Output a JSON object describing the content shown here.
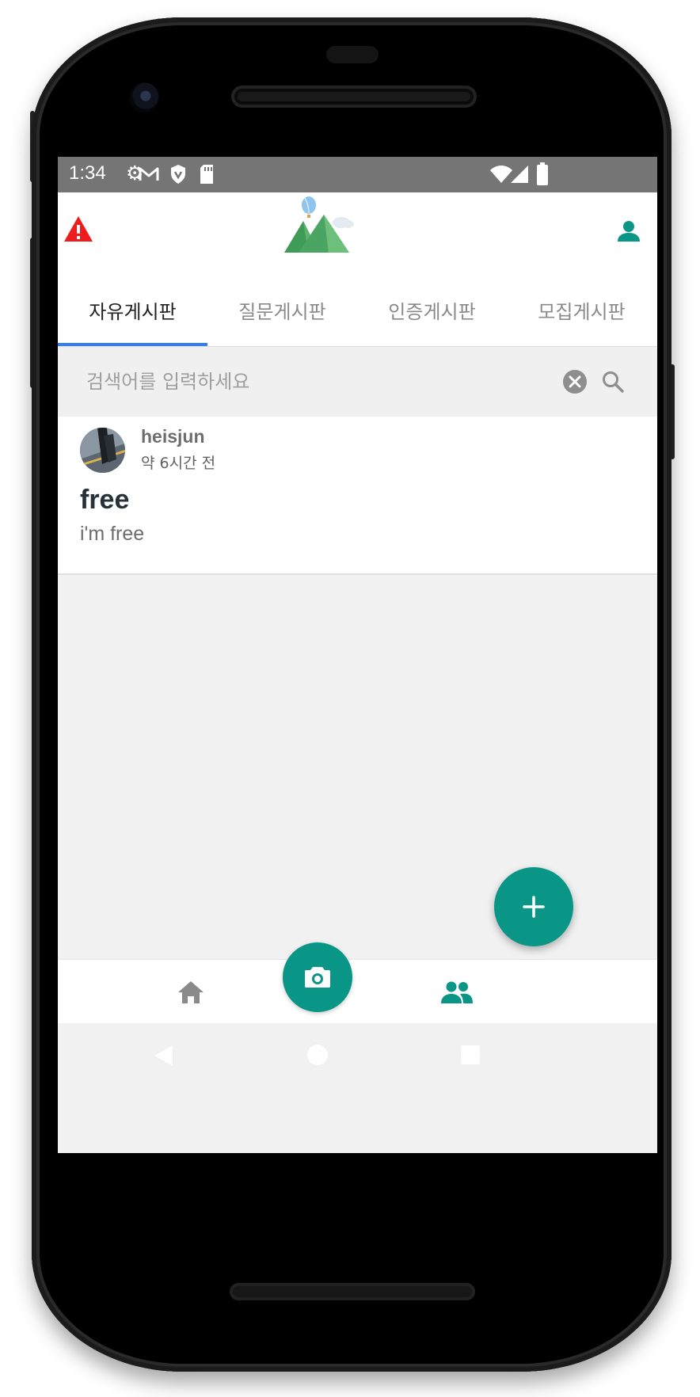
{
  "status_bar": {
    "time": "1:34",
    "icons": [
      "settings-icon",
      "gmail-icon",
      "shield-icon",
      "sd-card-icon",
      "wifi-icon",
      "signal-icon",
      "battery-icon"
    ]
  },
  "app_bar": {
    "left_icon": "warning-icon",
    "logo": "mountain-balloon-logo",
    "right_icon": "account-icon"
  },
  "tabs": [
    {
      "label": "자유게시판",
      "active": true
    },
    {
      "label": "질문게시판",
      "active": false
    },
    {
      "label": "인증게시판",
      "active": false
    },
    {
      "label": "모집게시판",
      "active": false
    }
  ],
  "search": {
    "placeholder": "검색어를 입력하세요",
    "value": ""
  },
  "posts": [
    {
      "author": "heisjun",
      "time": "약 6시간 전",
      "title": "free",
      "body": "i'm free"
    }
  ],
  "bottom_nav": {
    "items": [
      "home-icon",
      "camera-icon",
      "people-icon"
    ],
    "active": "people-icon"
  },
  "colors": {
    "accent": "#0a9686",
    "tab_indicator": "#2f80ed",
    "status_bar": "#757575",
    "warning": "#ee1c1c"
  }
}
